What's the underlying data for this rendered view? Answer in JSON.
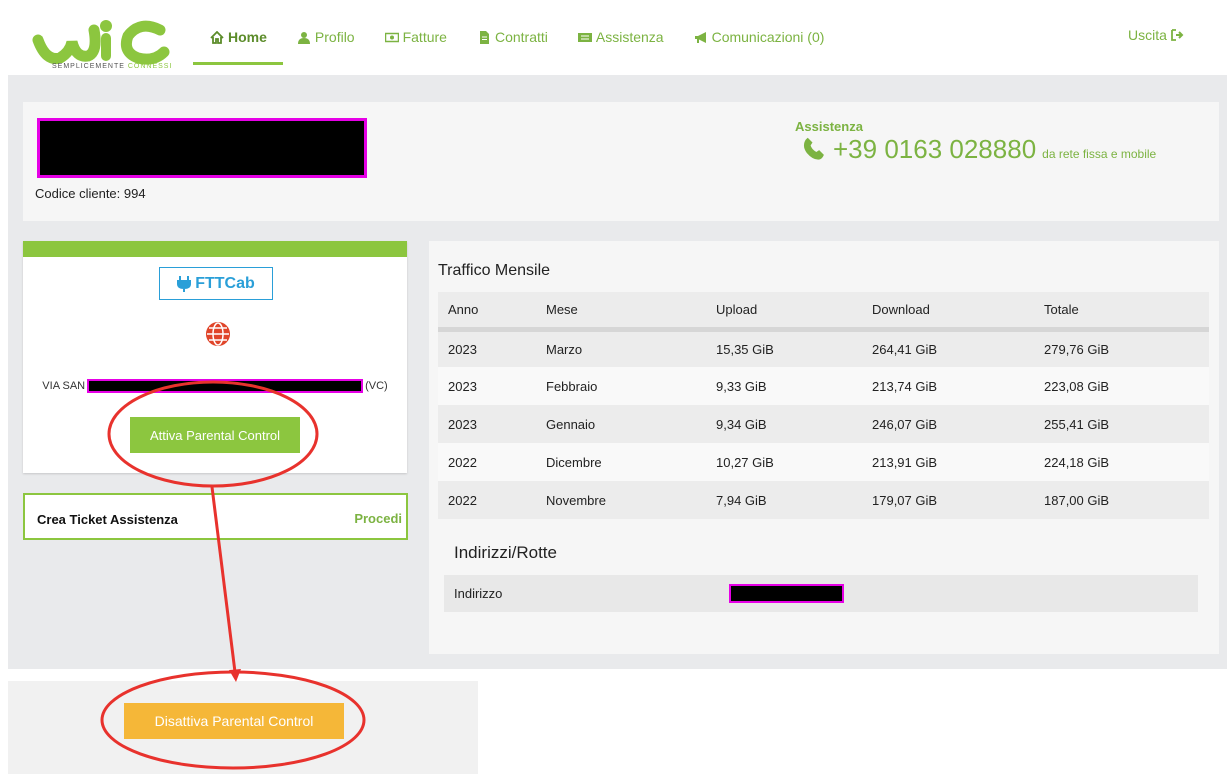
{
  "header": {
    "logo_tagline_a": "SEMPLICEMENTE",
    "logo_tagline_b": "CONNESSI",
    "nav": [
      {
        "label": "Home",
        "icon": "home-icon"
      },
      {
        "label": "Profilo",
        "icon": "user-icon"
      },
      {
        "label": "Fatture",
        "icon": "money-icon"
      },
      {
        "label": "Contratti",
        "icon": "file-icon"
      },
      {
        "label": "Assistenza",
        "icon": "ticket-icon"
      },
      {
        "label": "Comunicazioni (0)",
        "icon": "megaphone-icon"
      }
    ],
    "logout_label": "Uscita"
  },
  "customer": {
    "code_label": "Codice cliente: 994",
    "assist_label": "Assistenza",
    "phone": "+39 0163 028880",
    "phone_note": "da rete fissa e mobile"
  },
  "connection": {
    "tech": "FTTCab",
    "address_prefix": "VIA SAN",
    "address_suffix": "(VC)",
    "parental_button": "Attiva Parental Control"
  },
  "ticket": {
    "title": "Crea Ticket Assistenza",
    "action": "Procedi"
  },
  "traffic": {
    "title": "Traffico Mensile",
    "columns": [
      "Anno",
      "Mese",
      "Upload",
      "Download",
      "Totale"
    ],
    "rows": [
      [
        "2023",
        "Marzo",
        "15,35 GiB",
        "264,41 GiB",
        "279,76 GiB"
      ],
      [
        "2023",
        "Febbraio",
        "9,33 GiB",
        "213,74 GiB",
        "223,08 GiB"
      ],
      [
        "2023",
        "Gennaio",
        "9,34 GiB",
        "246,07 GiB",
        "255,41 GiB"
      ],
      [
        "2022",
        "Dicembre",
        "10,27 GiB",
        "213,91 GiB",
        "224,18 GiB"
      ],
      [
        "2022",
        "Novembre",
        "7,94 GiB",
        "179,07 GiB",
        "187,00 GiB"
      ]
    ]
  },
  "routes": {
    "title": "Indirizzi/Rotte",
    "label": "Indirizzo"
  },
  "inset": {
    "disable_button": "Disattiva Parental Control"
  },
  "colors": {
    "brand_green": "#8cc63f",
    "link_green": "#7cb342",
    "tech_blue": "#2a9fd8",
    "disable_orange": "#f5b738",
    "annotation_red": "#e8322d",
    "redaction_magenta": "#e600e6"
  }
}
